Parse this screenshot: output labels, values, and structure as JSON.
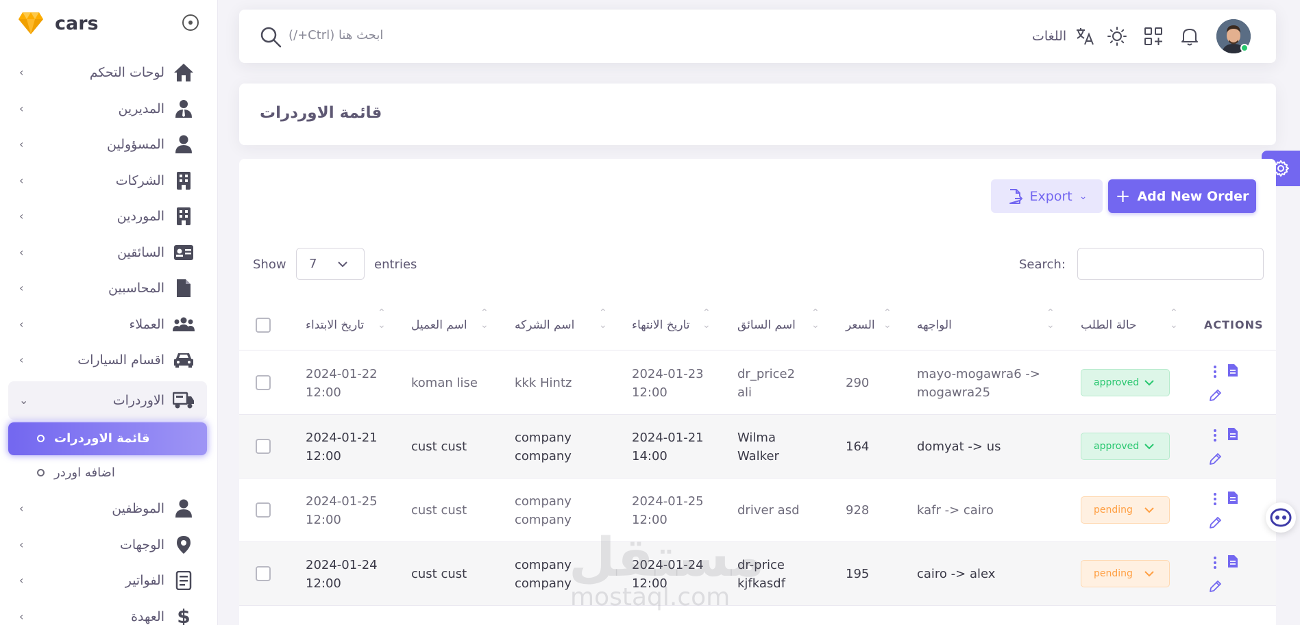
{
  "brand": {
    "name": "cars"
  },
  "sidebar": {
    "items": [
      {
        "label": "لوحات التحكم",
        "icon": "home-icon"
      },
      {
        "label": "المديرين",
        "icon": "manager-icon"
      },
      {
        "label": "المسؤولين",
        "icon": "user-icon"
      },
      {
        "label": "الشركات",
        "icon": "building-icon"
      },
      {
        "label": "الموردين",
        "icon": "building-icon"
      },
      {
        "label": "السائقين",
        "icon": "id-card-icon"
      },
      {
        "label": "المحاسبين",
        "icon": "file-icon"
      },
      {
        "label": "العملاء",
        "icon": "users-icon"
      },
      {
        "label": "اقسام السيارات",
        "icon": "car-icon"
      },
      {
        "label": "الاوردرات",
        "icon": "delivery-icon"
      }
    ],
    "sub_items": [
      {
        "label": "قائمة الاوردرات"
      },
      {
        "label": "اضافه اوردر"
      }
    ],
    "items_after": [
      {
        "label": "الموظفين",
        "icon": "user-icon"
      },
      {
        "label": "الوجهات",
        "icon": "location-icon"
      },
      {
        "label": "الفواتير",
        "icon": "invoice-icon"
      },
      {
        "label": "العهدة",
        "icon": "dollar-icon"
      }
    ]
  },
  "topbar": {
    "search_placeholder": "ابحث هنا (Ctrl+/)",
    "languages_label": "اللغات"
  },
  "page": {
    "title": "قائمة الاوردرات"
  },
  "toolbar": {
    "export_label": "Export",
    "add_label": "Add New Order"
  },
  "table_controls": {
    "show_label": "Show",
    "page_size": "7",
    "entries_label": "entries",
    "search_label": "Search:"
  },
  "table": {
    "headers": {
      "start_date": "تاريخ الابتداء",
      "client": "اسم العميل",
      "company": "اسم الشركه",
      "end_date": "تاريخ الانتهاء",
      "driver": "اسم السائق",
      "price": "السعر",
      "route": "الواجهه",
      "status": "حالة الطلب",
      "actions": "ACTIONS"
    },
    "rows": [
      {
        "start": "2024-01-22 12:00",
        "client": "koman lise",
        "company": "kkk Hintz",
        "end": "2024-01-23 12:00",
        "driver": "dr_price2 ali",
        "price": "290",
        "route": "mayo-mogawra6 -> mogawra25",
        "status": "approved"
      },
      {
        "start": "2024-01-21 12:00",
        "client": "cust cust",
        "company": "company company",
        "end": "2024-01-21 14:00",
        "driver": "Wilma Walker",
        "price": "164",
        "route": "domyat -> us",
        "status": "approved"
      },
      {
        "start": "2024-01-25 12:00",
        "client": "cust cust",
        "company": "company company",
        "end": "2024-01-25 12:00",
        "driver": "driver asd",
        "price": "928",
        "route": "kafr -> cairo",
        "status": "pending"
      },
      {
        "start": "2024-01-24 12:00",
        "client": "cust cust",
        "company": "company company",
        "end": "2024-01-24 12:00",
        "driver": "dr-price kjfkasdf",
        "price": "195",
        "route": "cairo -> alex",
        "status": "pending"
      }
    ]
  },
  "watermark": {
    "text": "مستقل",
    "domain": "mostaql.com"
  },
  "colors": {
    "primary": "#7367f0",
    "success": "#28c76f",
    "warning": "#ff9f43"
  }
}
